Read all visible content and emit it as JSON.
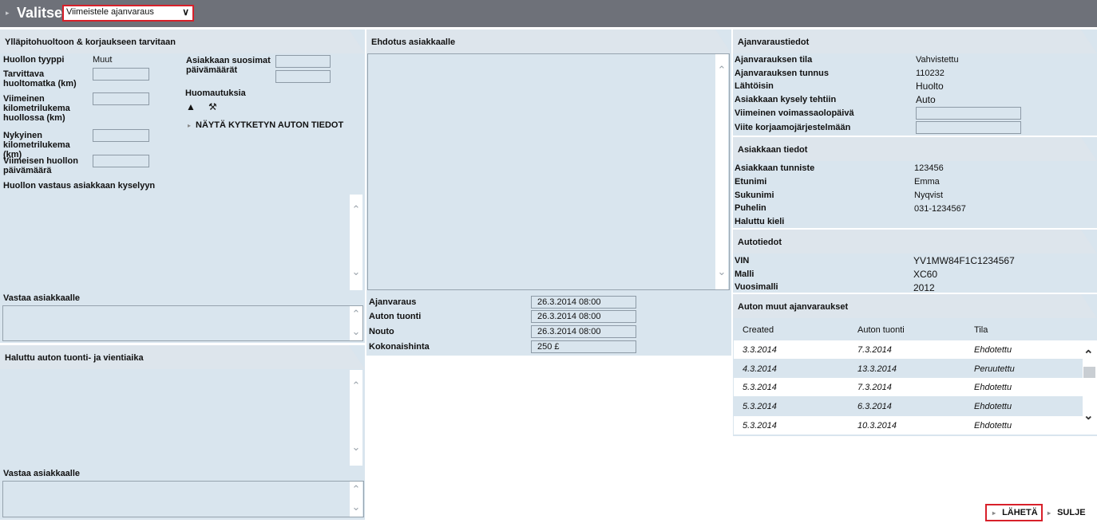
{
  "topbar": {
    "title": "Valitse",
    "select_value": "Viimeistele ajanvaraus"
  },
  "maintenance": {
    "header": "Ylläpitohuoltoon & korjaukseen tarvitaan",
    "service_type_label": "Huollon tyyppi",
    "service_type_value": "Muut",
    "required_mileage_label": "Tarvittava huoltomatka (km)",
    "last_mileage_label": "Viimeinen kilometrilukema huollossa (km)",
    "current_mileage_label": "Nykyinen kilometrilukema (km)",
    "last_service_date_label": "Viimeisen huollon päivämäärä",
    "preferred_dates_label": "Asiakkaan suosimat päivämäärät",
    "remarks_label": "Huomautuksia",
    "show_car_link": "NÄYTÄ KYTKETYN AUTON TIEDOT",
    "response_label": "Huollon vastaus asiakkaan kyselyyn",
    "reply_label": "Vastaa asiakkaalle"
  },
  "delivery": {
    "header": "Haluttu auton tuonti- ja vientiaika",
    "reply_label": "Vastaa asiakkaalle"
  },
  "proposal": {
    "header": "Ehdotus asiakkaalle",
    "booking_label": "Ajanvaraus",
    "booking_value": "26.3.2014 08:00",
    "dropoff_label": "Auton tuonti",
    "dropoff_value": "26.3.2014 08:00",
    "pickup_label": "Nouto",
    "pickup_value": "26.3.2014 08:00",
    "total_label": "Kokonaishinta",
    "total_value": "250 £"
  },
  "booking_info": {
    "header": "Ajanvaraustiedot",
    "status_label": "Ajanvarauksen tila",
    "status_value": "Vahvistettu",
    "id_label": "Ajanvarauksen tunnus",
    "id_value": "110232",
    "origin_label": "Lähtöisin",
    "origin_value": "Huolto",
    "inquiry_label": "Asiakkaan kysely tehtiin",
    "inquiry_value": "Auto",
    "valid_until_label": "Viimeinen voimassaolopäivä",
    "ref_label": "Viite korjaamojärjestelmään"
  },
  "customer": {
    "header": "Asiakkaan tiedot",
    "id_label": "Asiakkaan tunniste",
    "id_value": "123456",
    "first_label": "Etunimi",
    "first_value": "Emma",
    "last_label": "Sukunimi",
    "last_value": "Nyqvist",
    "phone_label": "Puhelin",
    "phone_value": "031-1234567",
    "lang_label": "Haluttu kieli"
  },
  "car": {
    "header": "Autotiedot",
    "vin_label": "VIN",
    "vin_value": "YV1MW84F1C1234567",
    "model_label": "Malli",
    "model_value": "XC60",
    "year_label": "Vuosimalli",
    "year_value": "2012"
  },
  "other_bookings": {
    "header": "Auton muut ajanvaraukset",
    "columns": [
      "Created",
      "Auton tuonti",
      "Tila"
    ],
    "rows": [
      [
        "3.3.2014",
        "7.3.2014",
        "Ehdotettu"
      ],
      [
        "4.3.2014",
        "13.3.2014",
        "Peruutettu"
      ],
      [
        "5.3.2014",
        "7.3.2014",
        "Ehdotettu"
      ],
      [
        "5.3.2014",
        "6.3.2014",
        "Ehdotettu"
      ],
      [
        "5.3.2014",
        "10.3.2014",
        "Ehdotettu"
      ]
    ]
  },
  "footer": {
    "send_label": "LÄHETÄ",
    "close_label": "SULJE"
  },
  "colors": {
    "panel": "#d9e5ee",
    "topbar": "#6e7179",
    "highlight": "#d8202a"
  }
}
